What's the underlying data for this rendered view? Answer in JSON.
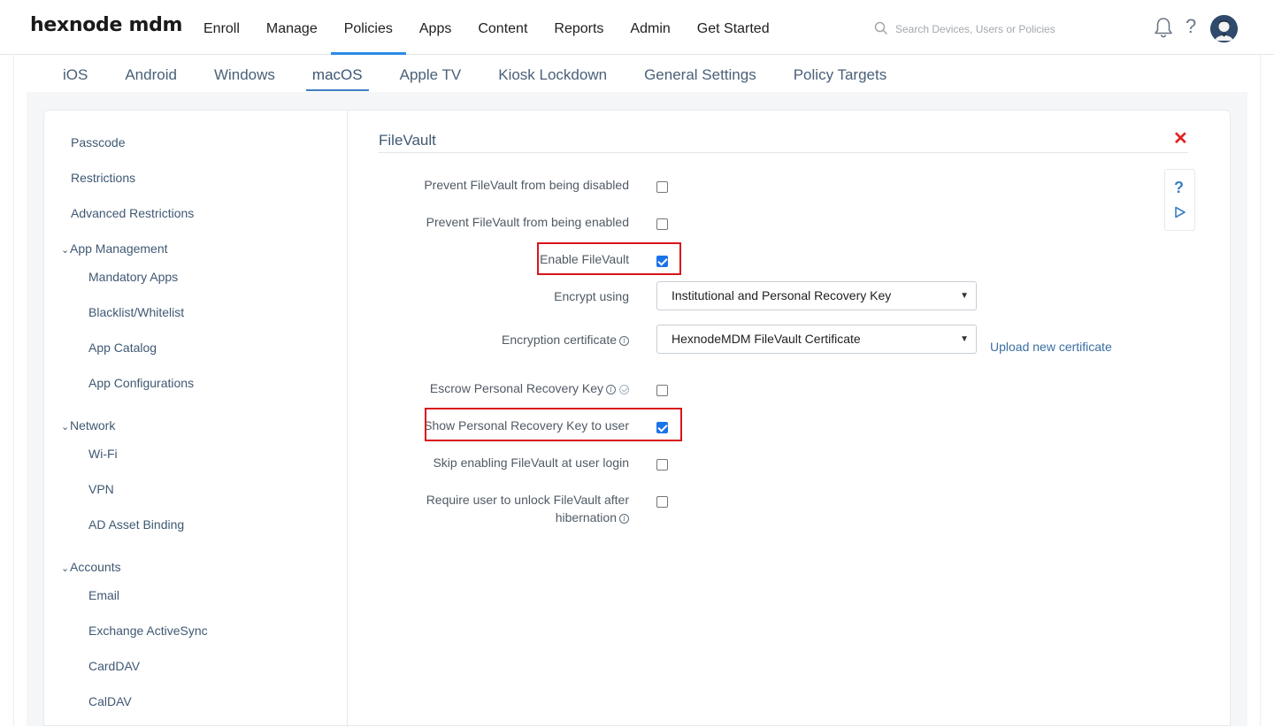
{
  "app": {
    "logo": "hexnode mdm"
  },
  "topnav": {
    "items": [
      {
        "label": "Enroll"
      },
      {
        "label": "Manage"
      },
      {
        "label": "Policies",
        "active": true
      },
      {
        "label": "Apps"
      },
      {
        "label": "Content"
      },
      {
        "label": "Reports"
      },
      {
        "label": "Admin"
      },
      {
        "label": "Get Started"
      }
    ],
    "search_placeholder": "Search Devices, Users or Policies",
    "help_label": "?"
  },
  "platform_tabs": [
    {
      "label": "iOS"
    },
    {
      "label": "Android"
    },
    {
      "label": "Windows"
    },
    {
      "label": "macOS",
      "active": true
    },
    {
      "label": "Apple TV"
    },
    {
      "label": "Kiosk Lockdown"
    },
    {
      "label": "General Settings"
    },
    {
      "label": "Policy Targets"
    }
  ],
  "sidebar": {
    "items": [
      {
        "label": "Passcode"
      },
      {
        "label": "Restrictions"
      },
      {
        "label": "Advanced Restrictions"
      }
    ],
    "groups": [
      {
        "label": "App Management",
        "children": [
          "Mandatory Apps",
          "Blacklist/Whitelist",
          "App Catalog",
          "App Configurations"
        ]
      },
      {
        "label": "Network",
        "children": [
          "Wi-Fi",
          "VPN",
          "AD Asset Binding"
        ]
      },
      {
        "label": "Accounts",
        "children": [
          "Email",
          "Exchange ActiveSync",
          "CardDAV",
          "CalDAV"
        ]
      }
    ]
  },
  "panel": {
    "title": "FileVault",
    "close_label": "✕",
    "help_label": "?",
    "settings": {
      "prevent_disable": {
        "label": "Prevent FileVault from being disabled",
        "checked": false
      },
      "prevent_enable": {
        "label": "Prevent FileVault from being enabled",
        "checked": false
      },
      "enable": {
        "label": "Enable FileVault",
        "checked": true
      },
      "encrypt_using": {
        "label": "Encrypt using",
        "value": "Institutional and Personal Recovery Key"
      },
      "certificate": {
        "label": "Encryption certificate",
        "value": "HexnodeMDM FileVault Certificate",
        "link": "Upload new certificate"
      },
      "escrow": {
        "label": "Escrow Personal Recovery Key",
        "checked": false
      },
      "show_key": {
        "label": "Show Personal Recovery Key to user",
        "checked": true
      },
      "skip_login": {
        "label": "Skip enabling FileVault at user login",
        "checked": false
      },
      "require_unlock": {
        "label_line1": "Require user to unlock FileVault after",
        "label_line2": "hibernation",
        "checked": false
      }
    }
  },
  "colors": {
    "accent": "#2b8be6",
    "highlight": "#d9141b",
    "checkbox_checked": "#1a73e8",
    "close": "#e02424"
  }
}
